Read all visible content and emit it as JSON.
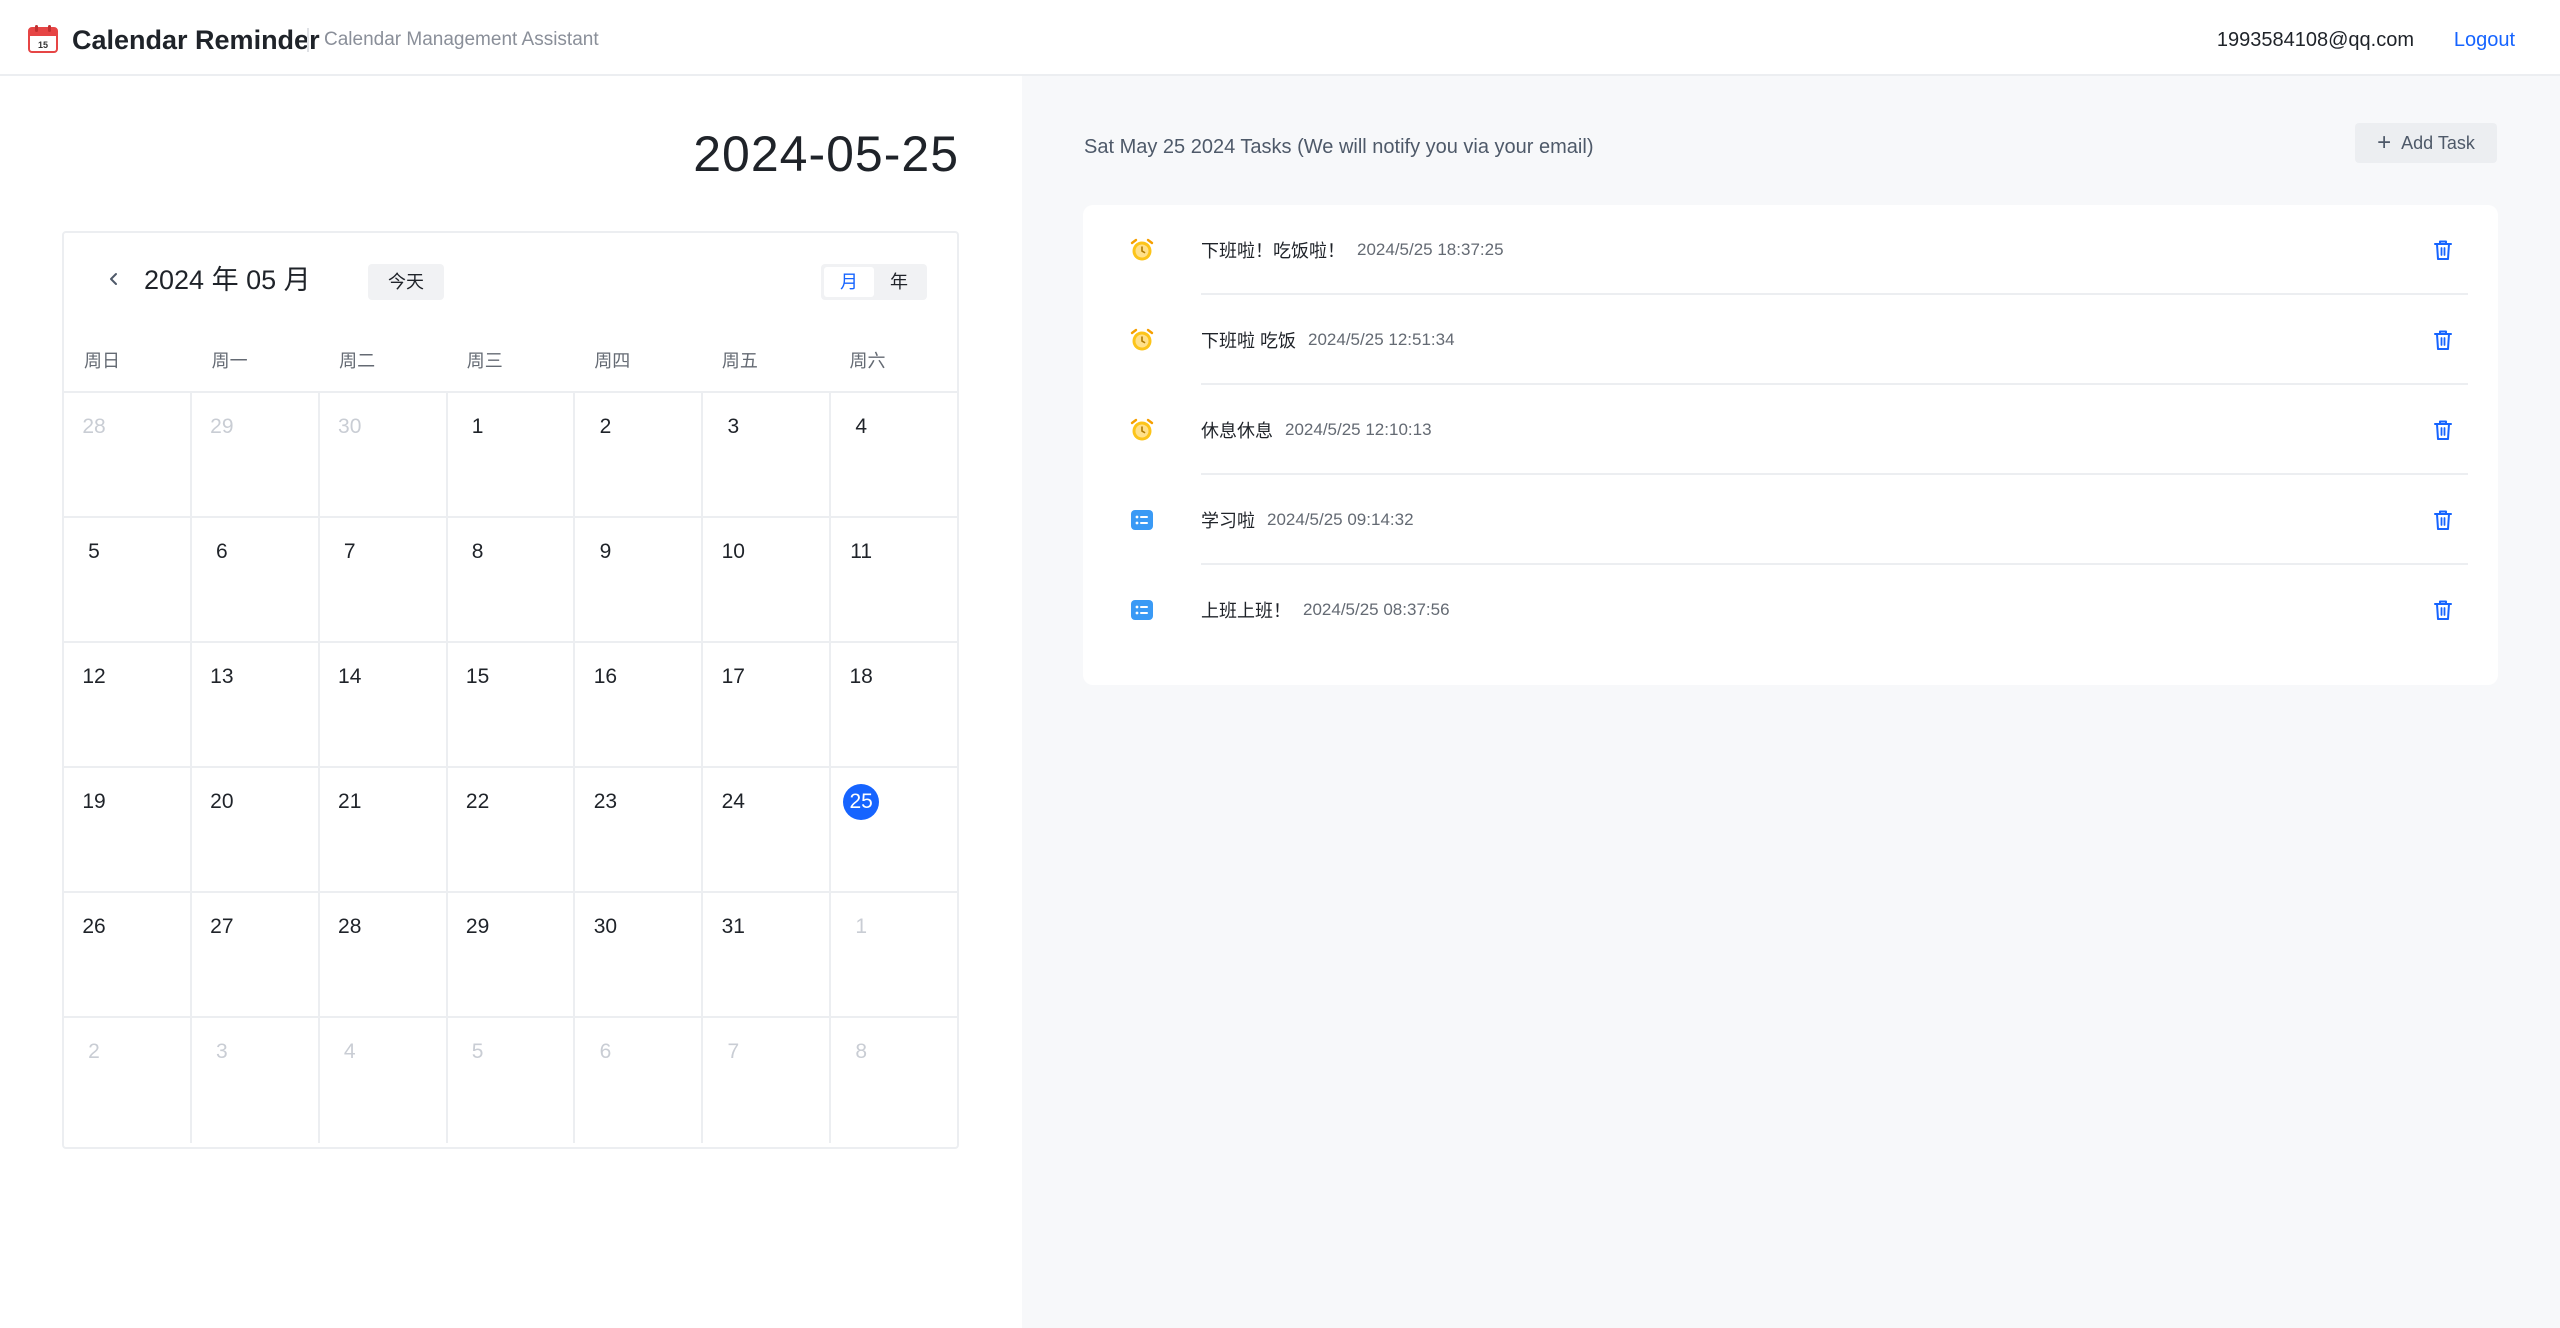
{
  "header": {
    "app_title": "Calendar Reminder",
    "app_subtitle": "Calendar Management Assistant",
    "user_email": "1993584108@qq.com",
    "logout_label": "Logout"
  },
  "calendar": {
    "selected_date": "2024-05-25",
    "month_label": "2024 年 05 月",
    "today_label": "今天",
    "view_month_label": "月",
    "view_year_label": "年",
    "active_view": "月",
    "weekdays": [
      "周日",
      "周一",
      "周二",
      "周三",
      "周四",
      "周五",
      "周六"
    ],
    "weeks": [
      [
        {
          "d": "28",
          "o": true
        },
        {
          "d": "29",
          "o": true
        },
        {
          "d": "30",
          "o": true
        },
        {
          "d": "1"
        },
        {
          "d": "2"
        },
        {
          "d": "3"
        },
        {
          "d": "4"
        }
      ],
      [
        {
          "d": "5"
        },
        {
          "d": "6"
        },
        {
          "d": "7"
        },
        {
          "d": "8"
        },
        {
          "d": "9"
        },
        {
          "d": "10"
        },
        {
          "d": "11"
        }
      ],
      [
        {
          "d": "12"
        },
        {
          "d": "13"
        },
        {
          "d": "14"
        },
        {
          "d": "15"
        },
        {
          "d": "16"
        },
        {
          "d": "17"
        },
        {
          "d": "18"
        }
      ],
      [
        {
          "d": "19"
        },
        {
          "d": "20"
        },
        {
          "d": "21"
        },
        {
          "d": "22"
        },
        {
          "d": "23"
        },
        {
          "d": "24"
        },
        {
          "d": "25",
          "s": true
        }
      ],
      [
        {
          "d": "26"
        },
        {
          "d": "27"
        },
        {
          "d": "28"
        },
        {
          "d": "29"
        },
        {
          "d": "30"
        },
        {
          "d": "31"
        },
        {
          "d": "1",
          "o": true
        }
      ],
      [
        {
          "d": "2",
          "o": true
        },
        {
          "d": "3",
          "o": true
        },
        {
          "d": "4",
          "o": true
        },
        {
          "d": "5",
          "o": true
        },
        {
          "d": "6",
          "o": true
        },
        {
          "d": "7",
          "o": true
        },
        {
          "d": "8",
          "o": true
        }
      ]
    ]
  },
  "tasks_panel": {
    "heading": "Sat May 25 2024 Tasks (We will notify you via your email)",
    "add_task_label": "Add Task",
    "tasks": [
      {
        "title": "下班啦！吃饭啦！",
        "time": "2024/5/25 18:37:25",
        "icon": "alarm-clock-icon"
      },
      {
        "title": "下班啦 吃饭",
        "time": "2024/5/25 12:51:34",
        "icon": "alarm-clock-icon"
      },
      {
        "title": "休息休息",
        "time": "2024/5/25 12:10:13",
        "icon": "alarm-clock-icon"
      },
      {
        "title": "学习啦",
        "time": "2024/5/25 09:14:32",
        "icon": "checklist-icon"
      },
      {
        "title": "上班上班！",
        "time": "2024/5/25 08:37:56",
        "icon": "checklist-icon"
      }
    ]
  },
  "colors": {
    "accent": "#1664ff",
    "alarm_yellow": "#fcc419",
    "checklist_blue": "#3a9af5",
    "logo_red": "#e64545"
  }
}
